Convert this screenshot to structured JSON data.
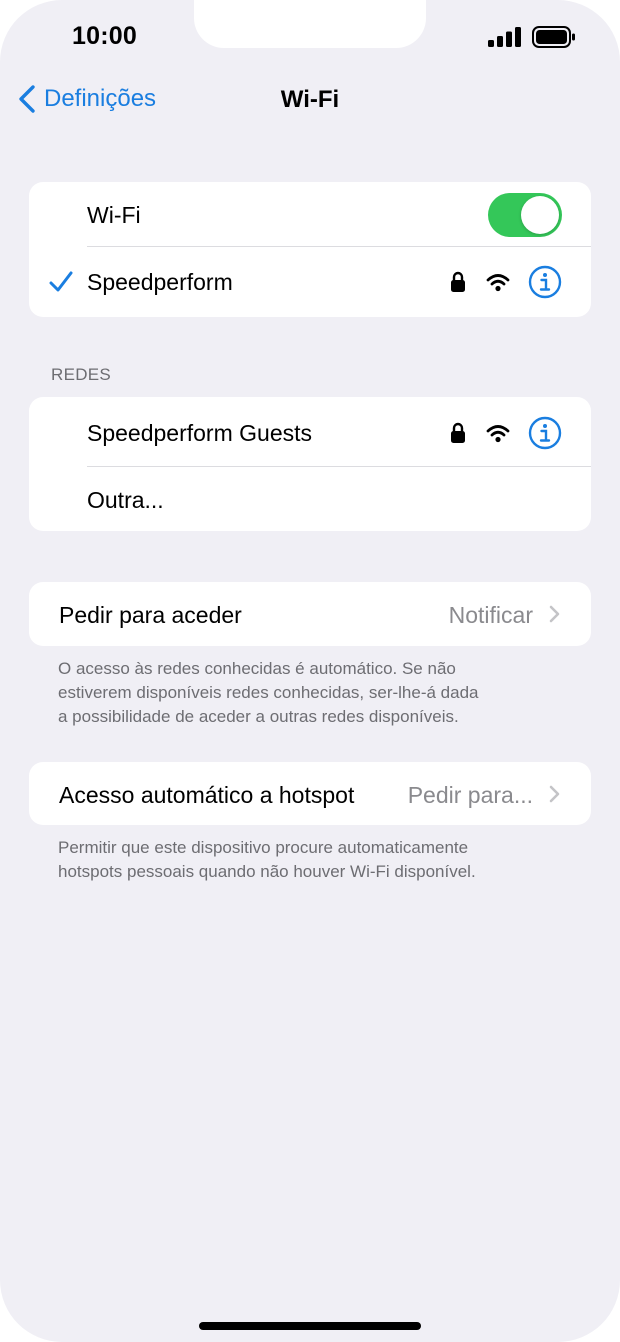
{
  "status_bar": {
    "time": "10:00"
  },
  "nav": {
    "back_label": "Definições",
    "title": "Wi-Fi"
  },
  "wifi_group": {
    "toggle_label": "Wi-Fi",
    "toggle_on": true,
    "connected_network": "Speedperform"
  },
  "networks_section": {
    "header": "REDES",
    "items": [
      {
        "name": "Speedperform Guests"
      },
      {
        "name": "Outra..."
      }
    ]
  },
  "ask_to_join": {
    "label": "Pedir para aceder",
    "value": "Notificar",
    "footer_line1": "O acesso às redes conhecidas é automático. Se não",
    "footer_line2": "estiverem disponíveis redes conhecidas, ser-lhe-á dada",
    "footer_line3": "a possibilidade de aceder a outras redes disponíveis."
  },
  "auto_hotspot": {
    "label": "Acesso automático a hotspot",
    "value": "Pedir para...",
    "footer_line1": "Permitir que este dispositivo procure automaticamente",
    "footer_line2": "hotspots pessoais quando não houver Wi-Fi disponível."
  },
  "colors": {
    "accent": "#1a7ee0",
    "toggle_on": "#34c759",
    "background": "#f0eff5"
  },
  "icons": [
    "chevron-left-icon",
    "checkmark-icon",
    "lock-icon",
    "wifi-icon",
    "info-icon",
    "chevron-right-icon",
    "signal-icon",
    "battery-icon"
  ]
}
